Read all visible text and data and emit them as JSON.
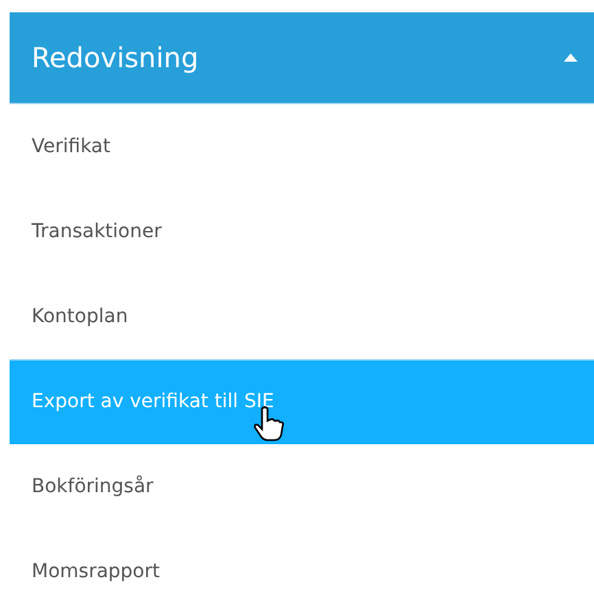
{
  "section": {
    "title": "Redovisning",
    "expanded": true
  },
  "items": [
    {
      "label": "Verifikat",
      "selected": false
    },
    {
      "label": "Transaktioner",
      "selected": false
    },
    {
      "label": "Kontoplan",
      "selected": false
    },
    {
      "label": "Export av verifikat till SIE",
      "selected": true
    },
    {
      "label": "Bokföringsår",
      "selected": false
    },
    {
      "label": "Momsrapport",
      "selected": false
    }
  ]
}
